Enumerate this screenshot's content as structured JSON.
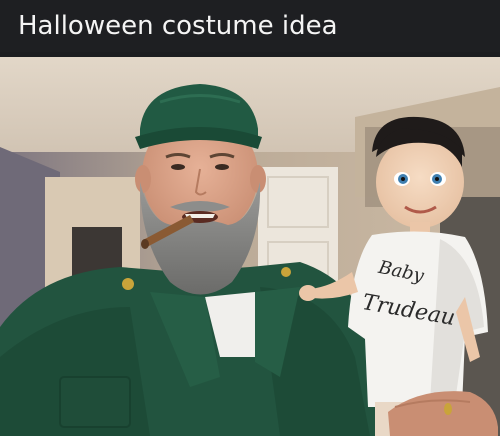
{
  "post": {
    "caption": "Halloween costume idea"
  },
  "photo": {
    "shirt_text_line1": "Baby",
    "shirt_text_line2": "Trudeau",
    "colors": {
      "uniform_green": "#22543f",
      "cap_green": "#215a43",
      "beard_gray": "#7d7d7b",
      "wall_beige": "#c9b8a2",
      "ceiling": "#d8ccbc",
      "doll_shirt": "#f4f3f0"
    }
  }
}
